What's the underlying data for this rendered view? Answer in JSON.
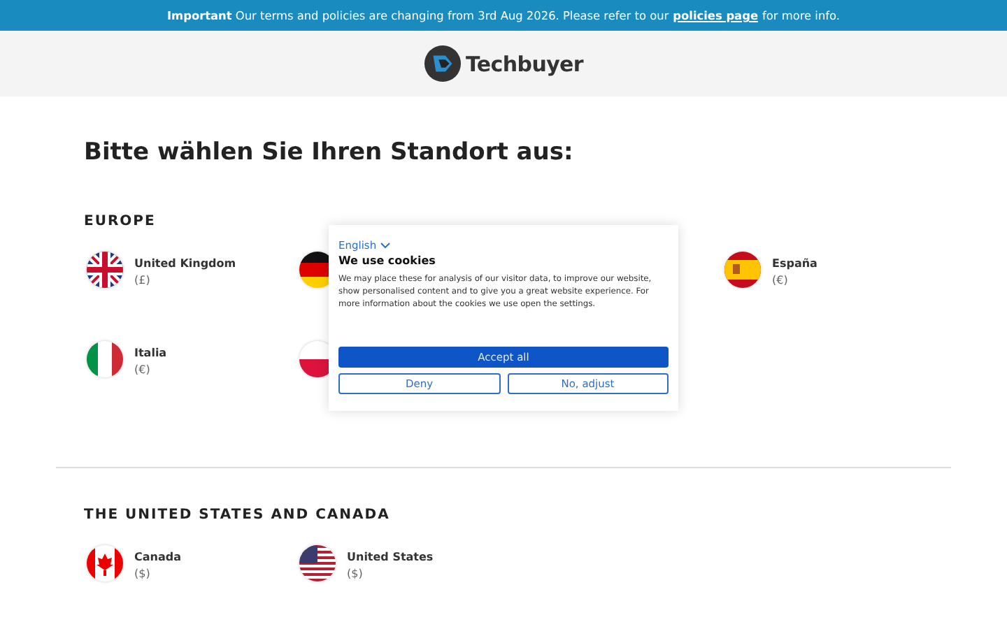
{
  "banner": {
    "text": "**Important** Our terms and policies are changing from 3rd Aug 2026. Please refer to our",
    "link": "policies page",
    "after": "for more info."
  },
  "header": {
    "logo": "Techbuyer"
  },
  "title": "Bitte wählen Sie Ihren Standort aus:",
  "regions": [
    {
      "heading": "EUROPE",
      "rows": [
        [
          {
            "kind": "uk",
            "name": "United Kingdom",
            "currency": "(£)"
          },
          {
            "kind": "de"
          },
          {
            "kind": "es",
            "name": "España",
            "currency": "(€)"
          }
        ],
        [
          {
            "kind": "it",
            "name": "Italia",
            "currency": "(€)"
          },
          {
            "kind": "pl"
          }
        ]
      ]
    },
    {
      "heading": "THE UNITED STATES AND CANADA",
      "rows": [
        [
          {
            "kind": "ca",
            "name": "Canada",
            "currency": "($)"
          },
          {
            "kind": "us",
            "name": "United States",
            "currency": "($)"
          }
        ]
      ]
    }
  ],
  "cookies": {
    "language": "English",
    "title": "We use cookies",
    "text": "We may place these for analysis of our visitor data, to improve our website, show personalised content and to give you a great website experience. For more information about the cookies we use open the settings.",
    "accept": "Accept all",
    "deny": "Deny",
    "adjust": "No, adjust"
  }
}
